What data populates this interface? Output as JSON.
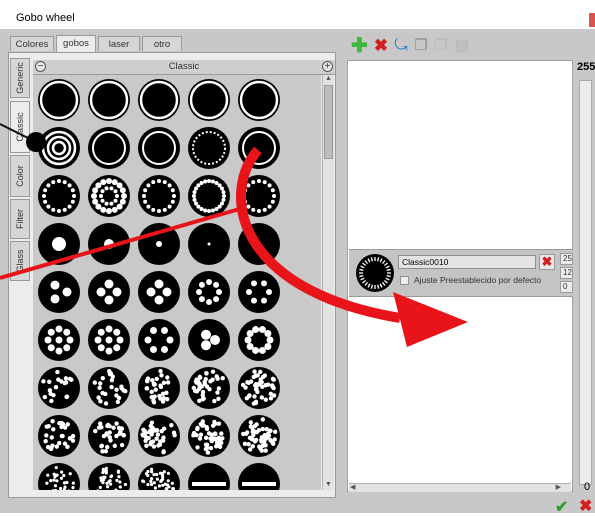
{
  "window": {
    "title": "Gobo wheel"
  },
  "top_tabs": [
    {
      "label": "Colores"
    },
    {
      "label": "gobos"
    },
    {
      "label": "laser"
    },
    {
      "label": "otro"
    }
  ],
  "side_tabs": [
    {
      "label": "Generic"
    },
    {
      "label": "Classic"
    },
    {
      "label": "Color"
    },
    {
      "label": "Filter"
    },
    {
      "label": "Glass"
    }
  ],
  "category_header": {
    "title": "Classic",
    "collapse_icon": "minus-circle-icon",
    "expand_icon": "plus-circle-icon"
  },
  "gobo_grid": {
    "columns": 5,
    "rows_visible": 9,
    "style": "black-circle-patterns"
  },
  "toolbar": [
    {
      "icon": "add-plus-icon",
      "color": "#3cb83c"
    },
    {
      "icon": "delete-x-icon",
      "color": "#d21e1e"
    },
    {
      "icon": "refresh-arrow-icon",
      "color": "#2d7fd3"
    },
    {
      "icon": "copy-icon",
      "color": "#8a8a8a"
    },
    {
      "icon": "paste-icon",
      "color": "#8a8a8a"
    },
    {
      "icon": "clipboard-icon",
      "color": "#8a8a8a"
    }
  ],
  "slot": {
    "name": "Classic0010",
    "default_label": "Ajuste Preestablecido por defecto",
    "spin_values": [
      "25",
      "12",
      "0"
    ]
  },
  "fader": {
    "top_value": "255",
    "bottom_value": "0"
  },
  "footer": {
    "ok_icon": "check-icon",
    "cancel_icon": "cancel-x-icon"
  },
  "colors": {
    "accent_red": "#e8141a",
    "toolbar_green": "#3cb83c",
    "toolbar_red": "#d21e1e"
  }
}
